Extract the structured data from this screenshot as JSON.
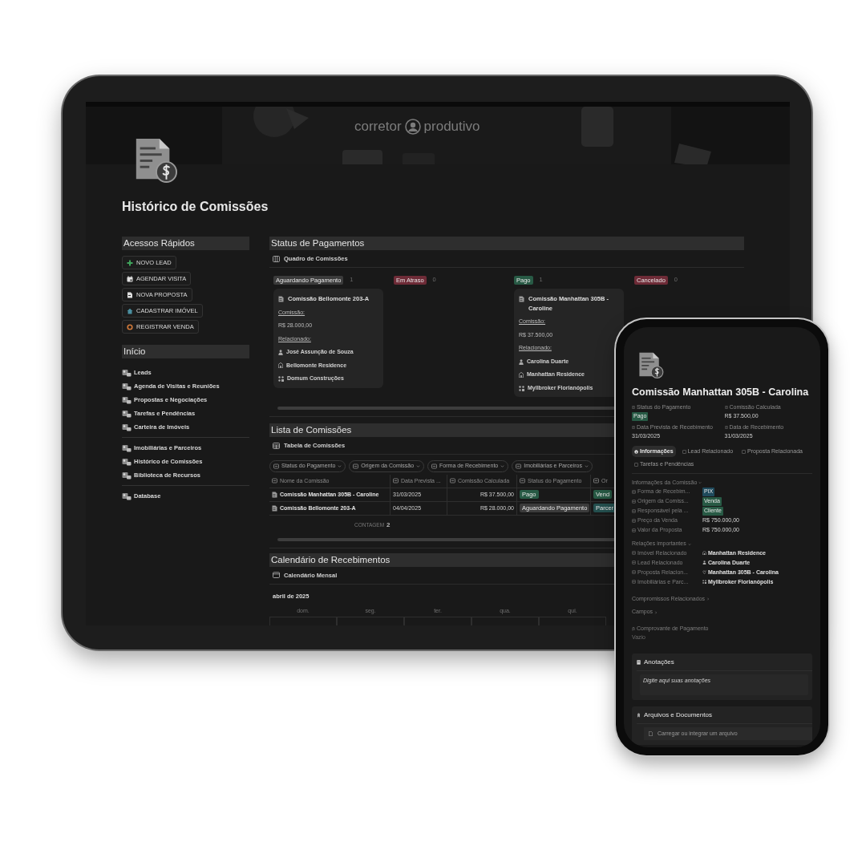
{
  "cover": {
    "kind": "picture",
    "logo_left": "corretor",
    "logo_right": "produtivo"
  },
  "page": {
    "title": "Histórico de Comissões",
    "quick_access": {
      "heading": "Acessos Rápidos",
      "buttons": [
        "NOVO LEAD",
        "AGENDAR VISITA",
        "NOVA PROPOSTA",
        "CADASTRAR IMÓVEL",
        "REGISTRAR VENDA"
      ]
    },
    "home": {
      "heading": "Início",
      "groups": [
        {
          "links": [
            "Leads",
            "Agenda de Visitas e Reuniões",
            "Propostas e Negociações",
            "Tarefas e Pendências",
            "Carteira de Imóveis"
          ]
        },
        {
          "links": [
            "Imobiliárias e Parceiros",
            "Histórico de Comissões",
            "Biblioteca de Recursos"
          ]
        },
        {
          "links": [
            "Database"
          ]
        }
      ]
    },
    "payments": {
      "heading": "Status de Pagamentos",
      "view": "Quadro de Comissões",
      "columns": [
        {
          "status": "Aguardando Pagamento",
          "color": "#3b3b3b",
          "count": "1",
          "cards": [
            {
              "title": "Comissão Bellomonte 203-A",
              "commission_label": "Comissão:",
              "commission": "R$ 28.000,00",
              "related_label": "Relacionado:",
              "related": [
                {
                  "kind": "person",
                  "name": "José Assunção de Souza"
                },
                {
                  "kind": "building",
                  "name": "Bellomonte Residence"
                },
                {
                  "kind": "company",
                  "name": "Domum Construções"
                }
              ]
            }
          ]
        },
        {
          "status": "Em Atraso",
          "color": "#6e2b37",
          "count": "0"
        },
        {
          "status": "Pago",
          "color": "#285a45",
          "count": "1",
          "cards": [
            {
              "title": "Comissão Manhattan 305B - Caroline",
              "commission_label": "Comissão:",
              "commission": "R$ 37.500,00",
              "related_label": "Relacionado:",
              "related": [
                {
                  "kind": "person",
                  "name": "Carolina Duarte"
                },
                {
                  "kind": "building",
                  "name": "Manhattan Residence"
                },
                {
                  "kind": "company",
                  "name": "Myllbroker Florianópolis"
                }
              ]
            }
          ]
        },
        {
          "status": "Cancelado",
          "color": "#6e2b37",
          "count": "0"
        }
      ]
    },
    "commissions": {
      "heading": "Lista de Comissões",
      "view": "Tabela de Comissões",
      "filters": [
        "Status do Pagamento",
        "Origem da Comissão",
        "Forma de Recebimento",
        "Imobiliárias e Parceiros"
      ],
      "columns": [
        "Nome da Comissão",
        "Data Prevista ...",
        "Comissão Calculada",
        "Status do Pagamento",
        "Or"
      ],
      "rows": [
        {
          "name": "Comissão Manhattan 305B - Caroline",
          "date": "31/03/2025",
          "amount": "R$ 37.500,00",
          "status": {
            "label": "Pago",
            "color": "#285a45"
          },
          "origin": {
            "label": "Vend",
            "color": "#285a45"
          }
        },
        {
          "name": "Comissão Bellomonte 203-A",
          "date": "04/04/2025",
          "amount": "R$ 28.000,00",
          "status": {
            "label": "Aguardando Pagamento",
            "color": "#3b3b3b"
          },
          "origin": {
            "label": "Parcer",
            "color": "#24504f"
          }
        }
      ],
      "count_label": "CONTAGEM",
      "count": "2"
    },
    "calendar": {
      "heading": "Calendário de Recebimentos",
      "view": "Calendário Mensal",
      "month": "abril de 2025",
      "weekdays": [
        "dom.",
        "seg.",
        "ter.",
        "qua.",
        "qui."
      ]
    }
  },
  "phone": {
    "title": "Comissão Manhattan 305B - Carolina",
    "properties": [
      {
        "label": "Status do Pagamento",
        "value": "Pago",
        "kind": "tag",
        "color": "#285a45"
      },
      {
        "label": "Comissão Calculada",
        "value": "R$ 37.500,00",
        "kind": "text"
      },
      {
        "label": "Data Prevista de Recebimento",
        "value": "31/03/2025",
        "kind": "text"
      },
      {
        "label": "Data de Recebimento",
        "value": "31/03/2025",
        "kind": "text"
      }
    ],
    "tabs": [
      {
        "label": "Informações",
        "selected": true
      },
      {
        "label": "Lead Relacionado",
        "selected": false
      },
      {
        "label": "Proposta Relacionada",
        "selected": false
      },
      {
        "label": "Tarefas e Pendências",
        "selected": false
      }
    ],
    "info": {
      "heading": "Informações da Comissão",
      "rows": [
        {
          "label": "Forma de Recebim...",
          "value": "PIX",
          "kind": "tag",
          "color": "#1f4a5c"
        },
        {
          "label": "Origem da Comiss...",
          "value": "Venda",
          "kind": "tag",
          "color": "#285a45"
        },
        {
          "label": "Responsável pela ...",
          "value": "Cliente",
          "kind": "tag",
          "color": "#285a45"
        },
        {
          "label": "Preço da Venda",
          "value": "R$ 750.000,00",
          "kind": "text"
        },
        {
          "label": "Valor da Proposta",
          "value": "R$ 750.000,00",
          "kind": "text"
        }
      ]
    },
    "relations": {
      "heading": "Relações importantes",
      "rows": [
        {
          "label": "Imóvel Relacionado",
          "value": "Manhattan Residence",
          "kind": "building"
        },
        {
          "label": "Lead Relacionado",
          "value": "Carolina Duarte",
          "kind": "person"
        },
        {
          "label": "Proposta Relacion...",
          "value": "Manhattan 305B - Carolina",
          "kind": "proposal"
        },
        {
          "label": "Imobiliárias e Parc...",
          "value": "Myllbroker Florianópolis",
          "kind": "company"
        }
      ]
    },
    "links": [
      "Compromissos Relacionados",
      "Campos"
    ],
    "receipt": {
      "label": "Comprovante de Pagamento",
      "value": "Vazio"
    },
    "notes": {
      "heading": "Anotações",
      "placeholder": "Digite aqui suas anotações"
    },
    "files": {
      "heading": "Arquivos e Documentos",
      "upload": "Carregar ou integrar um arquivo"
    }
  }
}
